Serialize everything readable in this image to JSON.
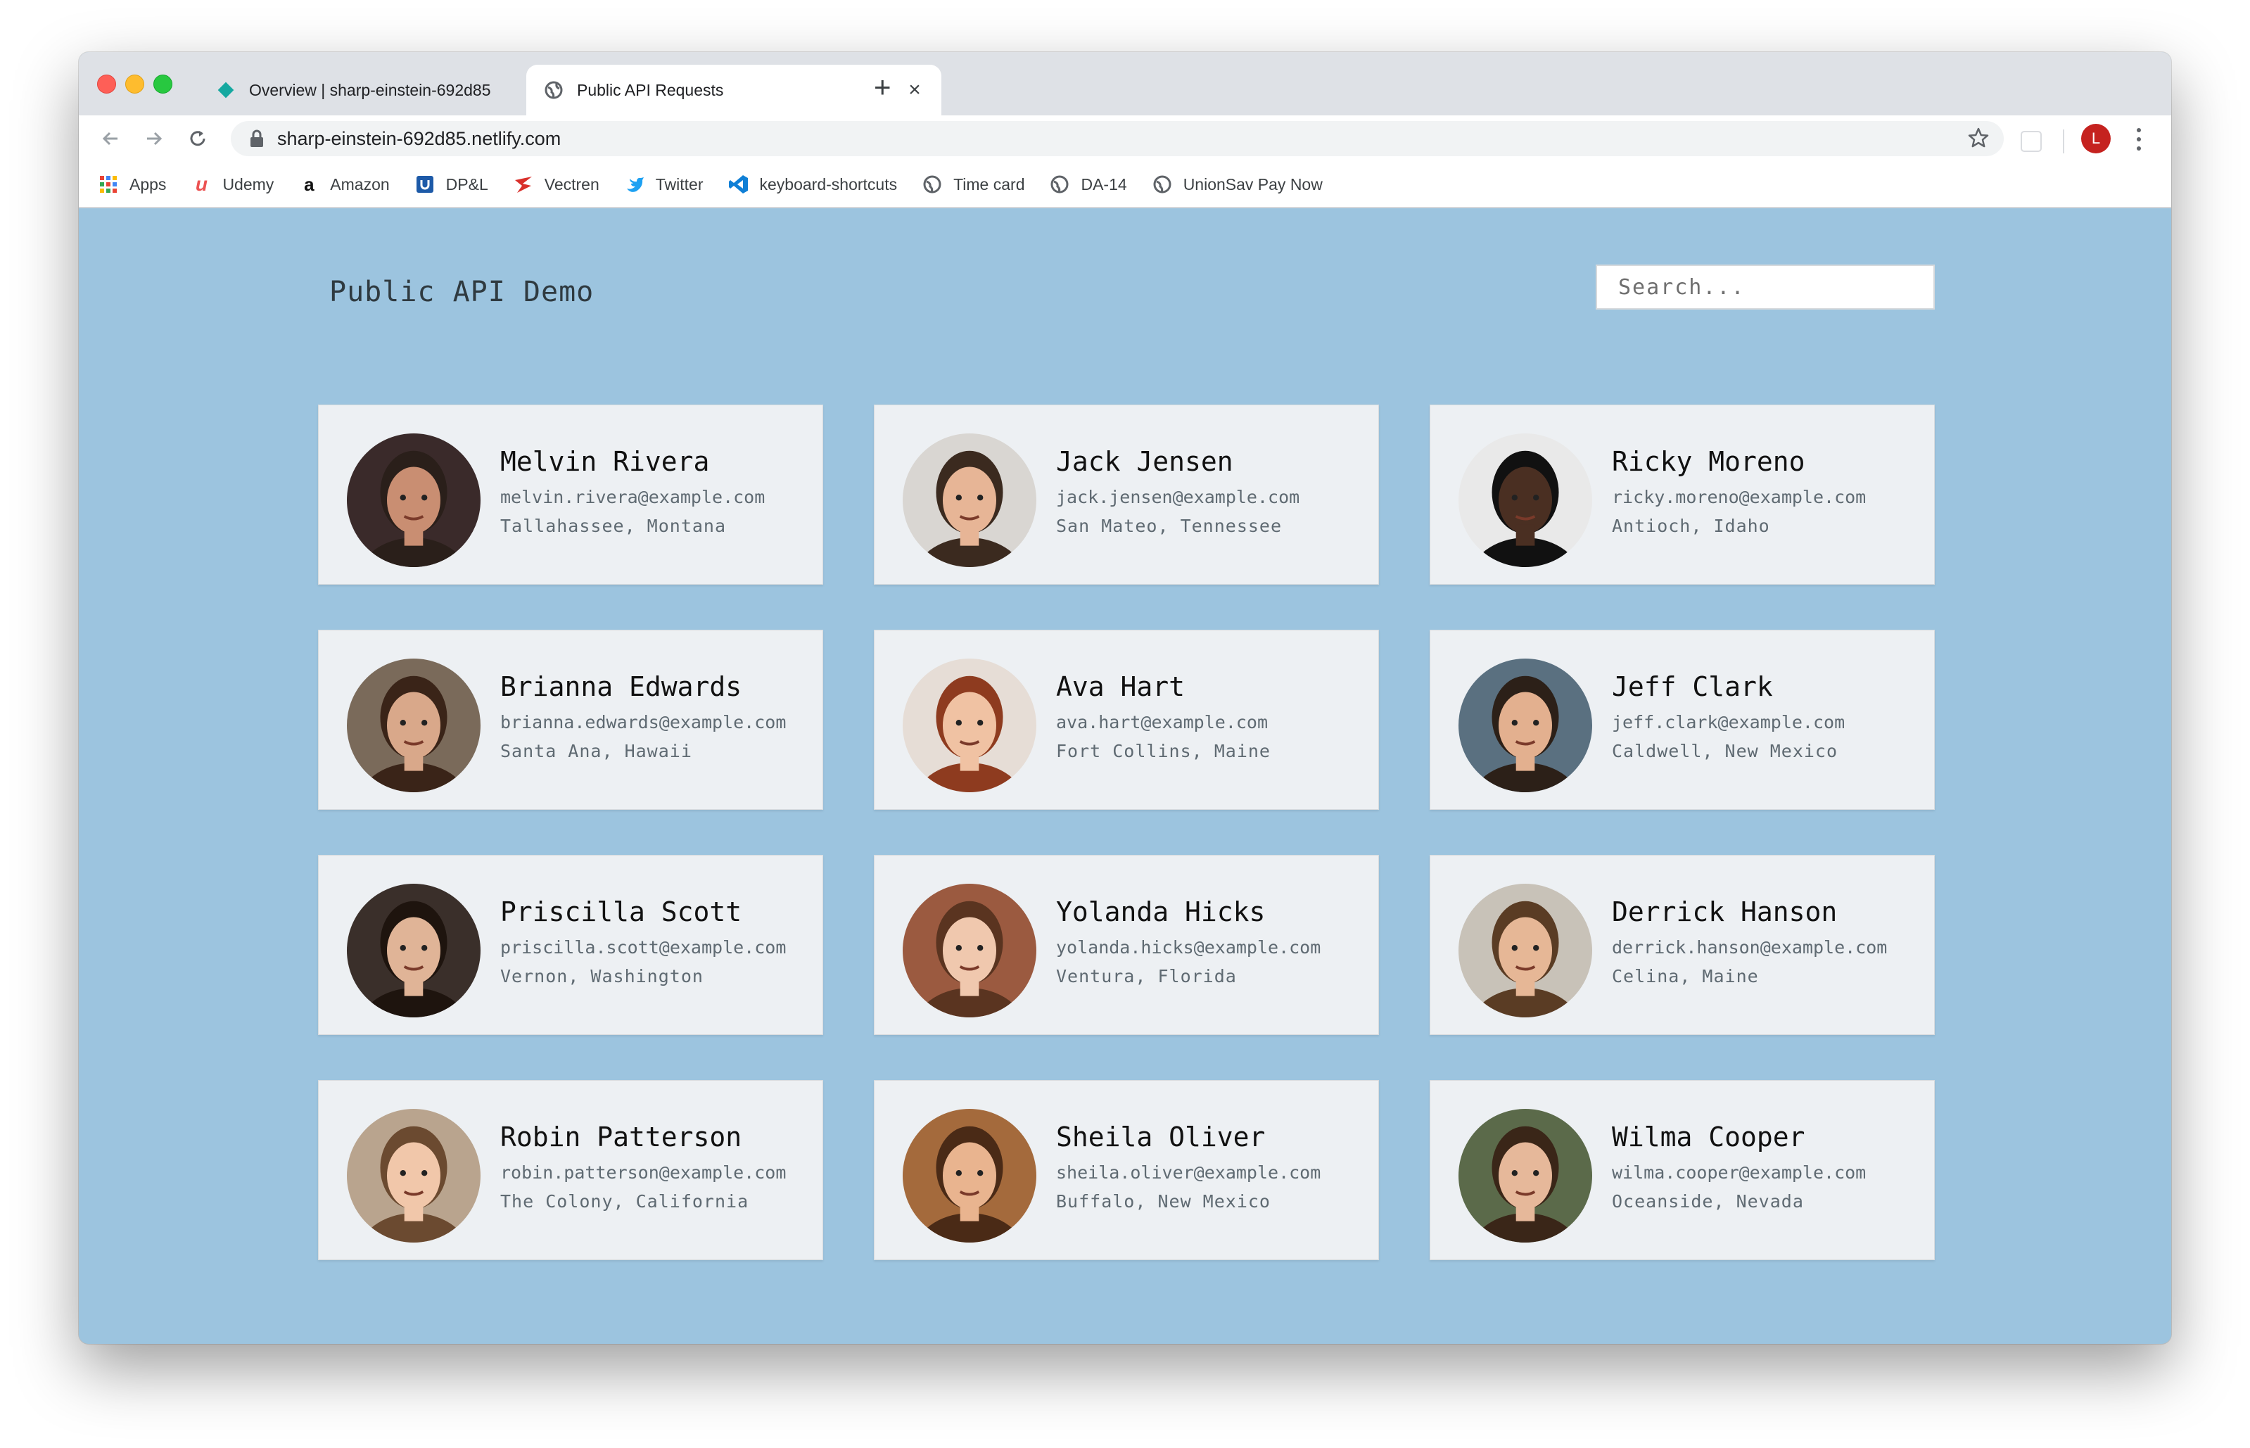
{
  "browser": {
    "tabs": [
      {
        "title": "Overview | sharp-einstein-692d85",
        "icon": "netlify-diamond-icon",
        "active": false
      },
      {
        "title": "Public API Requests",
        "icon": "globe-icon",
        "active": true
      }
    ],
    "url": "sharp-einstein-692d85.netlify.com",
    "profile_initial": "L",
    "bookmarks": [
      {
        "label": "Apps",
        "icon": "apps-grid-icon"
      },
      {
        "label": "Udemy",
        "icon": "udemy-icon"
      },
      {
        "label": "Amazon",
        "icon": "amazon-icon"
      },
      {
        "label": "DP&L",
        "icon": "dpl-icon"
      },
      {
        "label": "Vectren",
        "icon": "vectren-icon"
      },
      {
        "label": "Twitter",
        "icon": "twitter-bird-icon"
      },
      {
        "label": "keyboard-shortcuts",
        "icon": "vscode-icon"
      },
      {
        "label": "Time card",
        "icon": "globe-icon"
      },
      {
        "label": "DA-14",
        "icon": "globe-icon"
      },
      {
        "label": "UnionSav Pay Now",
        "icon": "globe-icon"
      }
    ]
  },
  "page": {
    "title": "Public API Demo",
    "search_placeholder": "Search...",
    "background": "#9cc4df"
  },
  "employees": [
    {
      "name": "Melvin Rivera",
      "email": "melvin.rivera@example.com",
      "location": "Tallahassee, Montana"
    },
    {
      "name": "Jack Jensen",
      "email": "jack.jensen@example.com",
      "location": "San Mateo, Tennessee"
    },
    {
      "name": "Ricky Moreno",
      "email": "ricky.moreno@example.com",
      "location": "Antioch, Idaho"
    },
    {
      "name": "Brianna Edwards",
      "email": "brianna.edwards@example.com",
      "location": "Santa Ana, Hawaii"
    },
    {
      "name": "Ava Hart",
      "email": "ava.hart@example.com",
      "location": "Fort Collins, Maine"
    },
    {
      "name": "Jeff Clark",
      "email": "jeff.clark@example.com",
      "location": "Caldwell, New Mexico"
    },
    {
      "name": "Priscilla Scott",
      "email": "priscilla.scott@example.com",
      "location": "Vernon, Washington"
    },
    {
      "name": "Yolanda Hicks",
      "email": "yolanda.hicks@example.com",
      "location": "Ventura, Florida"
    },
    {
      "name": "Derrick Hanson",
      "email": "derrick.hanson@example.com",
      "location": "Celina, Maine"
    },
    {
      "name": "Robin Patterson",
      "email": "robin.patterson@example.com",
      "location": "The Colony, California"
    },
    {
      "name": "Sheila Oliver",
      "email": "sheila.oliver@example.com",
      "location": "Buffalo, New Mexico"
    },
    {
      "name": "Wilma Cooper",
      "email": "wilma.cooper@example.com",
      "location": "Oceanside, Nevada"
    }
  ]
}
